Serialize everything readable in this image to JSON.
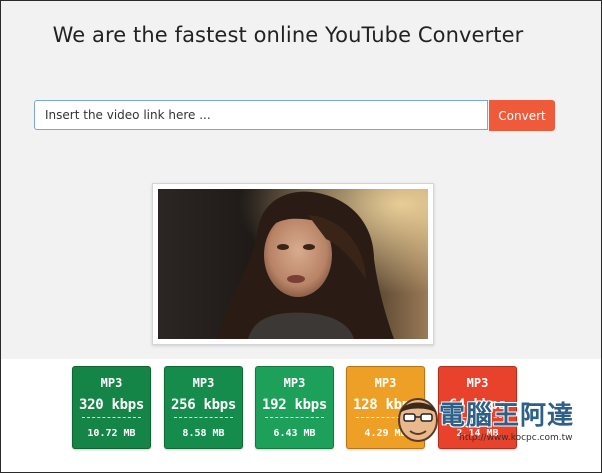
{
  "page": {
    "headline": "We are the fastest online YouTube Converter"
  },
  "search": {
    "placeholder": "Insert the video link here ...",
    "value": "",
    "button_label": "Convert"
  },
  "video": {
    "icon": "video-thumbnail-woman"
  },
  "downloads": [
    {
      "format": "MP3",
      "bitrate": "320 kbps",
      "size": "10.72 MB",
      "color": "#148447"
    },
    {
      "format": "MP3",
      "bitrate": "256 kbps",
      "size": "8.58 MB",
      "color": "#168c4c"
    },
    {
      "format": "MP3",
      "bitrate": "192 kbps",
      "size": "6.43 MB",
      "color": "#1da05a"
    },
    {
      "format": "MP3",
      "bitrate": "128 kbps",
      "size": "4.29 MB",
      "color": "#eda025"
    },
    {
      "format": "MP3",
      "bitrate": "64 kbps",
      "size": "2.14 MB",
      "color": "#e8422c"
    }
  ],
  "watermark": {
    "title": "電腦王阿達",
    "url": "http://www.kocpc.com.tw",
    "icon": "mascot-face-icon"
  }
}
